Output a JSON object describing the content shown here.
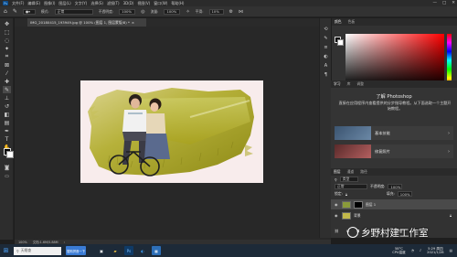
{
  "menubar": {
    "logo": "Ps",
    "items": [
      "文件(F)",
      "编辑(E)",
      "图像(I)",
      "图层(L)",
      "文字(Y)",
      "选择(S)",
      "滤镜(T)",
      "3D(D)",
      "视图(V)",
      "窗口(W)",
      "帮助(H)"
    ],
    "controls": [
      "—",
      "□",
      "✕"
    ]
  },
  "options": {
    "mode_label": "模式:",
    "mode_value": "正常",
    "opacity_label": "不透明度:",
    "opacity_value": "100%",
    "flow_label": "流量:",
    "flow_value": "100%",
    "smooth_label": "平滑:",
    "smooth_value": "10%"
  },
  "document": {
    "tab_title": "IMG_20180415_193949.jpg @ 100% (图层 1, 图层蒙版/8) *",
    "tab_close": "×"
  },
  "status": {
    "zoom": "100%",
    "doc_info": "文档:1.6M/5.88M"
  },
  "color_panel": {
    "tabs": [
      "颜色",
      "色板"
    ]
  },
  "learn_panel": {
    "tabs": [
      "学习",
      "库",
      "调整"
    ],
    "title": "了解 Photoshop",
    "description": "直接在应用程序内查看提供的分步指导教程。从下面选取一个主题开始教程。",
    "cards": [
      {
        "label": "基本技能"
      },
      {
        "label": "修复照片"
      }
    ],
    "chevron": "›"
  },
  "layers_panel": {
    "tabs": [
      "图层",
      "通道",
      "路径"
    ],
    "search_value": "类型",
    "blend_mode": "正常",
    "opacity_label": "不透明度:",
    "opacity_value": "100%",
    "lock_label": "锁定:",
    "fill_label": "填充:",
    "fill_value": "100%",
    "layers": [
      {
        "name": "图层 1",
        "selected": true
      },
      {
        "name": "背景",
        "selected": false
      }
    ]
  },
  "taskbar": {
    "search_placeholder": "天眼查",
    "baidu_label": "搜狗拼音一下",
    "weather": "58°C",
    "weather_sub": "CPU温度",
    "time": "5:29 周四",
    "date": "2021/1/28"
  },
  "watermark": {
    "text": "乡野村建工作室"
  },
  "colors": {
    "ps_dark": "#323232",
    "accent_red": "#ff0000",
    "taskbar": "#1d2a38"
  }
}
